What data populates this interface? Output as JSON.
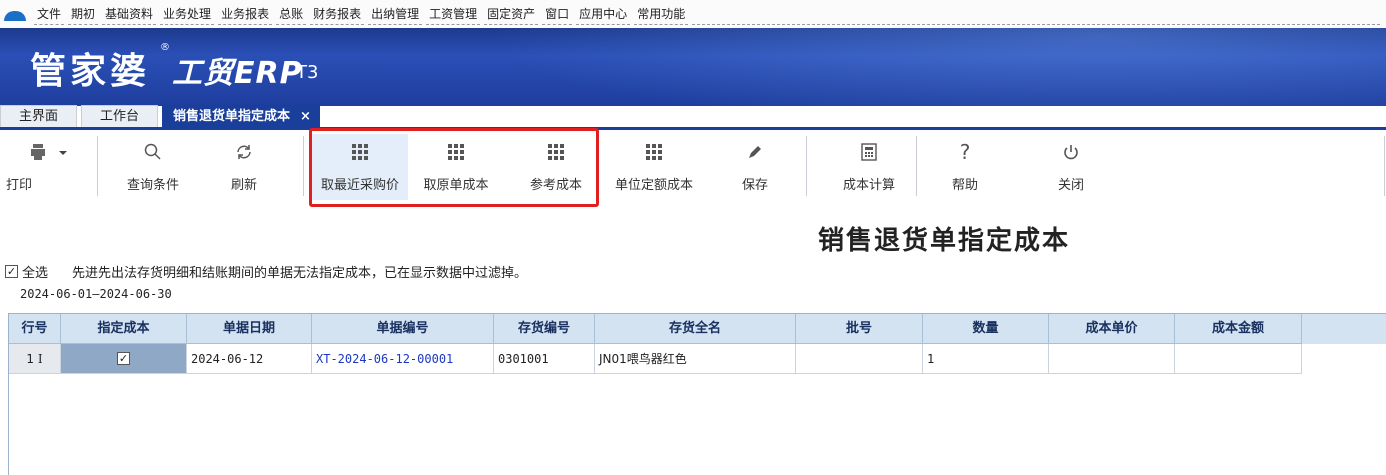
{
  "menubar": {
    "items": [
      "文件",
      "期初",
      "基础资料",
      "业务处理",
      "业务报表",
      "总账",
      "财务报表",
      "出纳管理",
      "工资管理",
      "固定资产",
      "窗口",
      "应用中心",
      "常用功能"
    ]
  },
  "banner": {
    "logo_cn": "管家婆",
    "logo_reg": "®",
    "logo_erp": "工贸ERP",
    "logo_ver": "T3"
  },
  "tabs": [
    {
      "label": "主界面"
    },
    {
      "label": "工作台"
    },
    {
      "label": "销售退货单指定成本",
      "close": "×"
    }
  ],
  "toolbar": {
    "print": "打印",
    "query": "查询条件",
    "refresh": "刷新",
    "recent_price": "取最近采购价",
    "orig_cost": "取原单成本",
    "ref_cost": "参考成本",
    "unit_quota": "单位定额成本",
    "save": "保存",
    "cost_calc": "成本计算",
    "help": "帮助",
    "close": "关闭"
  },
  "page": {
    "title": "销售退货单指定成本",
    "select_all": "全选",
    "notice": "先进先出法存货明细和结账期间的单据无法指定成本，已在显示数据中过滤掉。",
    "period": "2024-06-01—2024-06-30"
  },
  "table": {
    "headers": [
      "行号",
      "指定成本",
      "单据日期",
      "单据编号",
      "存货编号",
      "存货全名",
      "批号",
      "数量",
      "成本单价",
      "成本金额"
    ],
    "rows": [
      {
        "no": "1",
        "date": "2024-06-12",
        "doc": "XT-2024-06-12-00001",
        "code": "0301001",
        "name": "JN01喂鸟器红色",
        "batch": "",
        "qty": "1",
        "price": "",
        "amount": ""
      }
    ]
  },
  "colors": {
    "banner": "#1d3a8e",
    "tab_active": "#1a3f9b",
    "header_bg": "#d3e3f2",
    "highlight": "#e02020"
  }
}
